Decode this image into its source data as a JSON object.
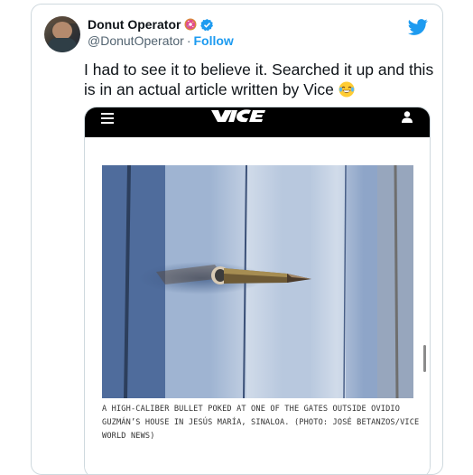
{
  "author": {
    "display_name": "Donut Operator",
    "handle": "@DonutOperator",
    "separator": "·",
    "follow_label": "Follow"
  },
  "tweet": {
    "text": "I had to see it to believe it. Searched it up and this is in an actual article written by Vice"
  },
  "embedded_article": {
    "site_logo": "VICE",
    "caption": "A HIGH-CALIBER BULLET POKED AT ONE OF THE GATES OUTSIDE OVIDIO GUZMÁN’S HOUSE IN JESÚS MARÍA, SINALOA. (PHOTO: JOSÉ BETANZOS/VICE WORLD NEWS)"
  },
  "colors": {
    "accent": "#1d9bf0",
    "text": "#0f1419",
    "muted": "#536471",
    "border": "#cfd9de",
    "vice_bar": "#000000"
  },
  "icons": [
    "twitter-bird-icon",
    "verified-badge-icon",
    "donut-emoji-icon",
    "laughing-tears-emoji-icon",
    "hamburger-menu-icon",
    "user-icon"
  ]
}
